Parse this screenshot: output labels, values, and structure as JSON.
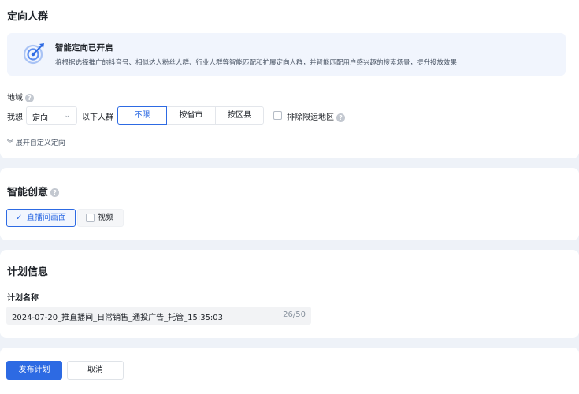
{
  "targeting": {
    "title": "定向人群",
    "banner": {
      "title": "智能定向已开启",
      "description": "将根据选择推广的抖音号、相似达人粉丝人群、行业人群等智能匹配和扩展定向人群，并智能匹配用户感兴趣的搜索场景，提升投放效果"
    },
    "region": {
      "label": "地域",
      "prefix": "我想",
      "mode_value": "定向",
      "suffix": "以下人群",
      "options": [
        "不限",
        "按省市",
        "按区县"
      ],
      "selected": "不限",
      "exclude_label": "排除限运地区"
    },
    "expand_label": "展开自定义定向"
  },
  "creative": {
    "title": "智能创意",
    "options": [
      "直播间画面",
      "视频"
    ],
    "selected": "直播间画面"
  },
  "plan": {
    "title": "计划信息",
    "name_label": "计划名称",
    "name_value": "2024-07-20_推直播间_日常销售_通投广告_托管_15:35:03",
    "name_count": "26/50"
  },
  "footer": {
    "publish_label": "发布计划",
    "cancel_label": "取消"
  },
  "colors": {
    "accent": "#2d6ae3",
    "page_background": "#eef2f8",
    "banner_background": "#f1f5fd"
  }
}
